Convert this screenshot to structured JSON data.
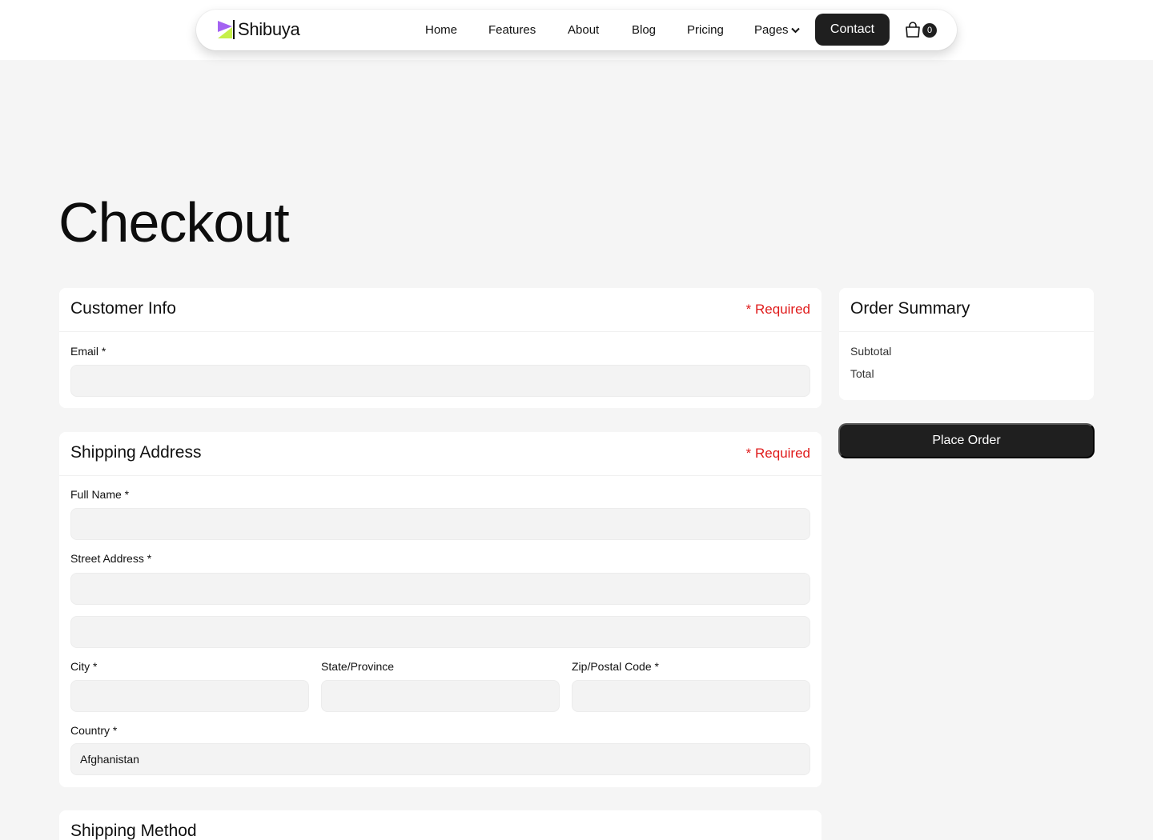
{
  "nav": {
    "brand": "Shibuya",
    "links": [
      "Home",
      "Features",
      "About",
      "Blog",
      "Pricing"
    ],
    "pages_label": "Pages",
    "contact_label": "Contact",
    "cart_count": "0"
  },
  "page_title": "Checkout",
  "customer_info": {
    "title": "Customer Info",
    "required_label": "* Required",
    "email_label": "Email *",
    "email_value": ""
  },
  "shipping_address": {
    "title": "Shipping Address",
    "required_label": "* Required",
    "full_name_label": "Full Name *",
    "street_label": "Street Address *",
    "city_label": "City *",
    "state_label": "State/Province",
    "zip_label": "Zip/Postal Code *",
    "country_label": "Country *",
    "country_value": "Afghanistan"
  },
  "shipping_method": {
    "title": "Shipping Method"
  },
  "order_summary": {
    "title": "Order Summary",
    "subtotal_label": "Subtotal",
    "total_label": "Total"
  },
  "place_order_label": "Place Order",
  "colors": {
    "accent_dark": "#1f1f1f",
    "required_red": "#e01b1b",
    "logo_purple": "#a463f2",
    "logo_lime": "#c6f04a"
  }
}
